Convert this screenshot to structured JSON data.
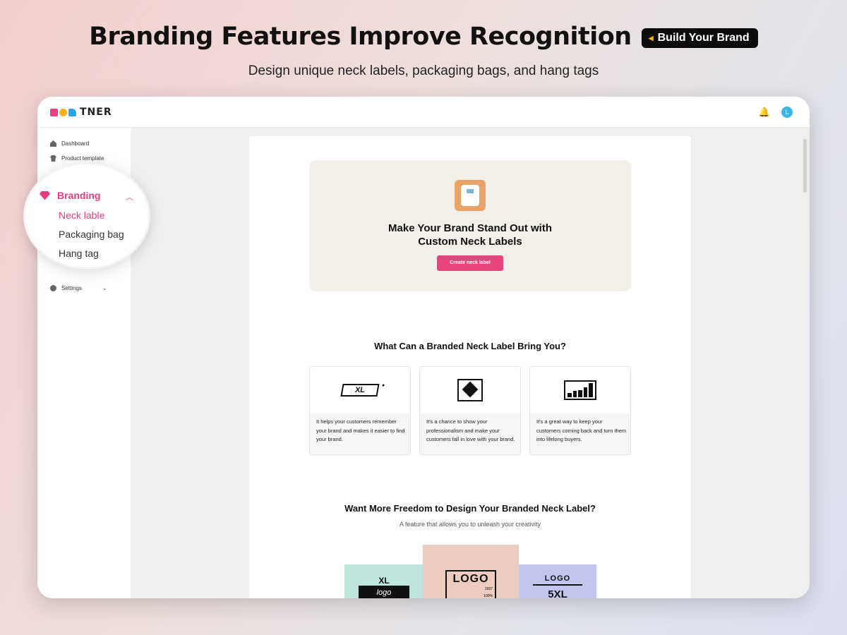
{
  "hero": {
    "title": "Branding Features Improve Recognition",
    "badge": "Build Your Brand",
    "subtitle": "Design unique neck labels, packaging bags, and hang tags"
  },
  "app": {
    "logo_text": "TNER",
    "avatar_letter": "L"
  },
  "sidebar": {
    "items": [
      {
        "label": "Dashboard",
        "icon": "home-icon"
      },
      {
        "label": "Product template",
        "icon": "tshirt-icon"
      },
      {
        "label": "Settings",
        "icon": "gear-icon"
      }
    ],
    "branding": {
      "label": "Branding",
      "subitems": [
        "Neck lable",
        "Packaging bag",
        "Hang tag"
      ],
      "active": "Neck lable"
    }
  },
  "promo": {
    "title_line1": "Make Your Brand Stand Out with",
    "title_line2": "Custom Neck Labels",
    "button": "Create neck label"
  },
  "benefits": {
    "title": "What Can a Branded Neck Label Bring You?",
    "cards": [
      {
        "icon": "xl-tag-icon",
        "icon_text": "XL",
        "text": "It helps your customers remember your brand and makes it easier to find your brand."
      },
      {
        "icon": "diamond-frame-icon",
        "text": "It's a chance to show your professionalism and make your customers fall in love with your brand."
      },
      {
        "icon": "bar-chart-icon",
        "text": "It's a great way to keep your customers coming back and turn them into lifelong buyers."
      }
    ]
  },
  "freedom": {
    "title": "Want More Freedom to Design Your Branded Neck Label?",
    "subtitle": "A feature that allows you to unleash your creativity",
    "labels": [
      {
        "size": "XL",
        "text": "logo"
      },
      {
        "text": "LOGO",
        "year": "1937",
        "pct": "100%"
      },
      {
        "text": "LOGO",
        "size": "5XL"
      }
    ]
  },
  "colors": {
    "accent": "#e8457f",
    "label_mint": "#bfe6dc",
    "label_peach": "#ecccc0",
    "label_lavender": "#c2c6ef"
  }
}
